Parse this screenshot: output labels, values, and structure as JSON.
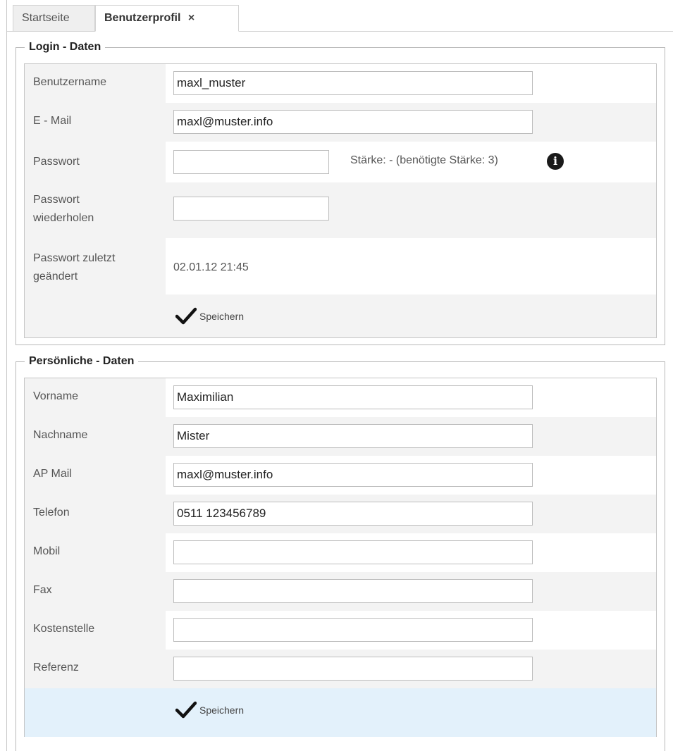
{
  "tabs": [
    {
      "label": "Startseite"
    },
    {
      "label": "Benutzerprofil",
      "close": "×"
    }
  ],
  "login": {
    "legend": "Login - Daten",
    "username_label": "Benutzername",
    "username_value": "maxl_muster",
    "email_label": "E - Mail",
    "email_value": "maxl@muster.info",
    "password_label": "Passwort",
    "password_value": "",
    "strength_text": "Stärke: - (benötigte Stärke: 3)",
    "password_repeat_label_1": "Passwort",
    "password_repeat_label_2": "wiederholen",
    "password_repeat_value": "",
    "last_changed_label_1": "Passwort zuletzt",
    "last_changed_label_2": "geändert",
    "last_changed_value": "02.01.12 21:45",
    "save_label": "Speichern"
  },
  "personal": {
    "legend": "Persönliche - Daten",
    "firstname_label": "Vorname",
    "firstname_value": "Maximilian",
    "lastname_label": "Nachname",
    "lastname_value": "Mister",
    "apmail_label": "AP Mail",
    "apmail_value": "maxl@muster.info",
    "phone_label": "Telefon",
    "phone_value": "0511 123456789",
    "mobile_label": "Mobil",
    "mobile_value": "",
    "fax_label": "Fax",
    "fax_value": "",
    "costcenter_label": "Kostenstelle",
    "costcenter_value": "",
    "reference_label": "Referenz",
    "reference_value": "",
    "save_label": "Speichern"
  },
  "icons": {
    "info": "info-icon",
    "check": "checkmark-icon",
    "close": "close-icon"
  },
  "colors": {
    "row_alt": "#f3f3f3",
    "row_highlight": "#e3f1fb",
    "border": "#c4c4c4"
  }
}
